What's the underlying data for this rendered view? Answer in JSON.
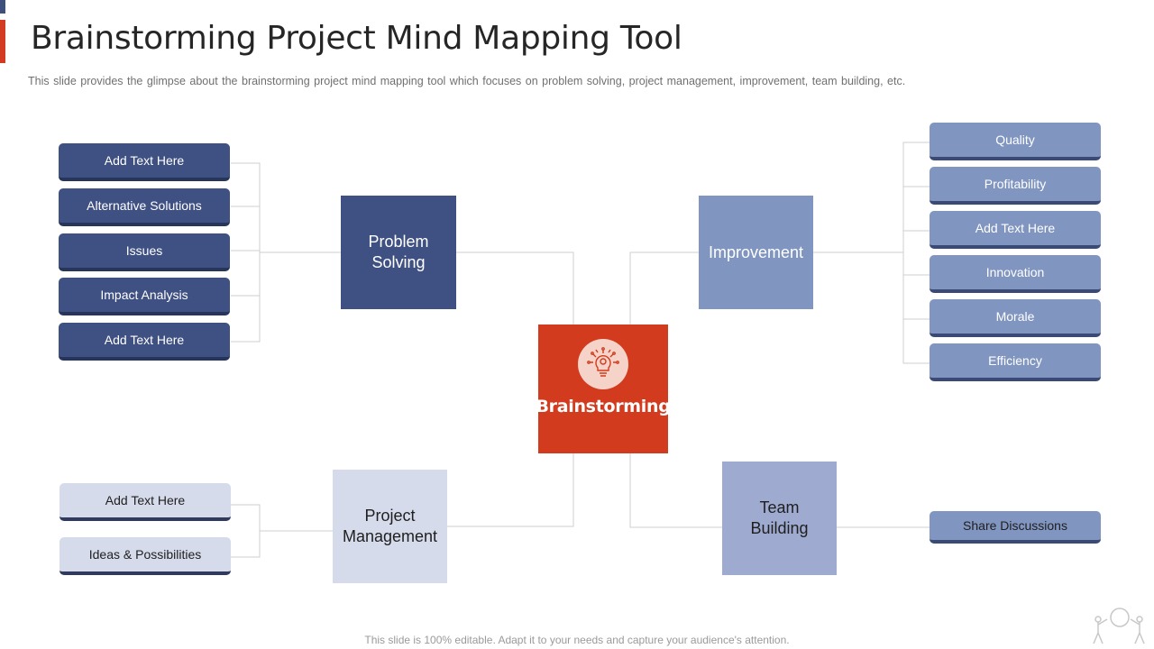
{
  "header": {
    "title": "Brainstorming Project Mind Mapping Tool",
    "subtitle": "This slide provides  the glimpse about the brainstorming  project mind mapping tool which focuses on problem solving,  project management,  improvement,  team building, etc."
  },
  "center": {
    "label": "Brainstorming",
    "icon": "lightbulb-gear-icon"
  },
  "branches": {
    "problem_solving": {
      "label_line1": "Problem",
      "label_line2": "Solving",
      "items": [
        "Add Text Here",
        "Alternative Solutions",
        "Issues",
        "Impact Analysis",
        "Add Text Here"
      ]
    },
    "project_management": {
      "label_line1": "Project",
      "label_line2": "Management",
      "items": [
        "Add Text Here",
        "Ideas & Possibilities"
      ]
    },
    "improvement": {
      "label": "Improvement",
      "items": [
        "Quality",
        "Profitability",
        "Add Text Here",
        "Innovation",
        "Morale",
        "Efficiency"
      ]
    },
    "team_building": {
      "label_line1": "Team",
      "label_line2": "Building",
      "items": [
        "Share Discussions"
      ]
    }
  },
  "colors": {
    "accent_red": "#d23b1e",
    "dark_navy": "#3f5082",
    "mid_blue": "#8095c0",
    "light_blue": "#d6dbeb",
    "team_blue": "#9eaacf"
  },
  "footer": {
    "text": "This slide is 100% editable. Adapt it to your needs and capture your audience's attention."
  }
}
